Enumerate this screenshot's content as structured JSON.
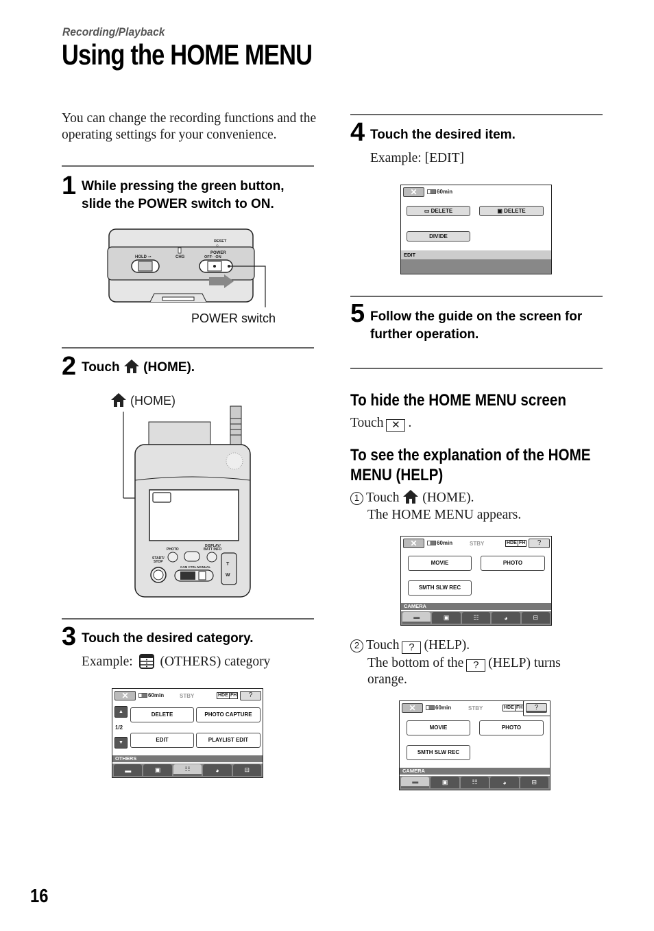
{
  "header": {
    "section": "Recording/Playback",
    "title": "Using the HOME MENU"
  },
  "intro": "You can change the recording functions and the operating settings for your convenience.",
  "steps": [
    {
      "number": "1",
      "heading_line1": "While pressing the green button,",
      "heading_line2": "slide the POWER switch to ON.",
      "figure": {
        "labels": {
          "reset": "RESET",
          "power": "POWER",
          "off_on": "OFF◦ ◦ON",
          "hold": "HOLD",
          "chg": "CHG"
        },
        "callout": "POWER switch"
      }
    },
    {
      "number": "2",
      "heading_prefix": "Touch",
      "heading_suffix": "(HOME).",
      "figure": {
        "callout": "(HOME)",
        "labels": {
          "photo": "PHOTO",
          "start_stop": "START/ STOP",
          "display": "DISPLAY/ BATT INFO",
          "cam_ctrl": "CAM CTRL",
          "manual": "MANUAL",
          "tele": "T",
          "wide": "W"
        }
      }
    },
    {
      "number": "3",
      "heading": "Touch the desired category.",
      "example_prefix": "Example:",
      "example_suffix": "(OTHERS) category"
    },
    {
      "number": "4",
      "heading": "Touch the desired item.",
      "example": "Example: [EDIT]"
    },
    {
      "number": "5",
      "heading_line1": "Follow the guide on the screen for",
      "heading_line2": "further operation."
    }
  ],
  "screens": {
    "common": {
      "close": "✕",
      "battery": "60min",
      "stby": "STBY",
      "hd": "HDE",
      "fh": "FH",
      "help": "?"
    },
    "others": {
      "buttons": [
        "DELETE",
        "PHOTO CAPTURE",
        "EDIT",
        "PLAYLIST EDIT"
      ],
      "page": "1/2",
      "up": "▲",
      "down": "▼",
      "category": "OTHERS",
      "active_tab": 2
    },
    "edit": {
      "buttons": [
        "DELETE",
        "DELETE",
        "DIVIDE"
      ],
      "category": "EDIT"
    },
    "camera": {
      "buttons": [
        "MOVIE",
        "PHOTO",
        "SMTH SLW REC"
      ],
      "category": "CAMERA",
      "active_tab": 0
    }
  },
  "hide_section": {
    "heading": "To hide the HOME MENU screen",
    "text_prefix": "Touch",
    "text_suffix": "."
  },
  "help_section": {
    "heading_line1": "To see the explanation of the HOME",
    "heading_line2": "MENU (HELP)",
    "step1_num": "1",
    "step1_prefix": "Touch",
    "step1_suffix": "(HOME).",
    "step1_note": "The HOME MENU appears.",
    "step2_num": "2",
    "step2_prefix": "Touch",
    "step2_suffix": "(HELP).",
    "step2_note_prefix": "The bottom of the",
    "step2_note_suffix": "(HELP) turns",
    "step2_note_end": "orange."
  },
  "page_number": "16"
}
